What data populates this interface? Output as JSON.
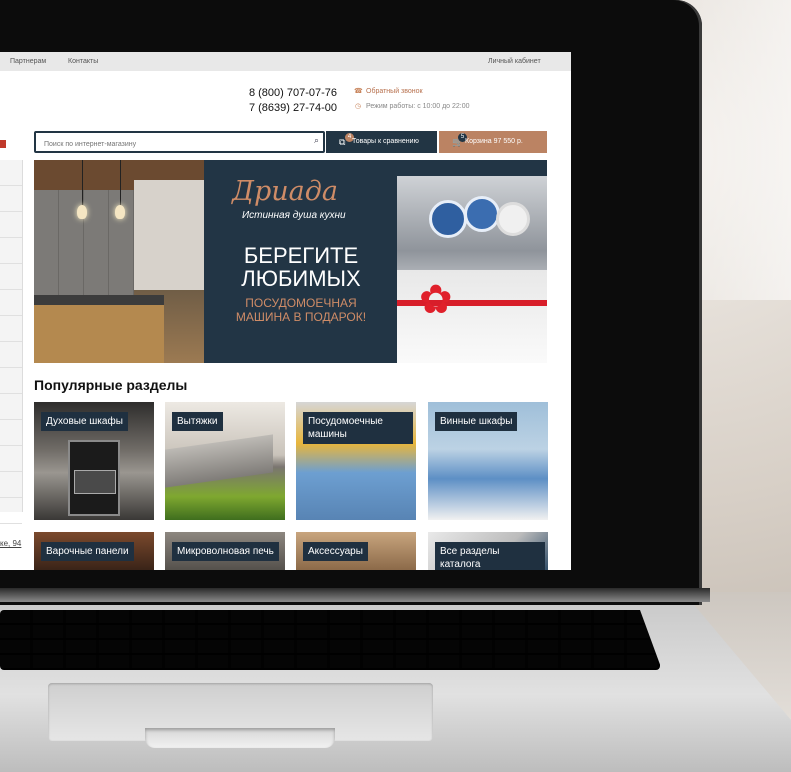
{
  "topbar": {
    "links": [
      "Партнерам",
      "Контакты"
    ],
    "account": "Личный кабинет"
  },
  "contacts": {
    "phone1": "8 (800) 707-07-76",
    "phone2": "7 (8639) 27-74-00",
    "callback": "Обратный звонок",
    "hours": "Режим работы: с 10:00 до 22:00"
  },
  "search": {
    "placeholder": "Поиск по интернет-магазину"
  },
  "compare": {
    "label": "Товары к сравнению",
    "count": "4"
  },
  "cart": {
    "label": "Корзина 97 550 р.",
    "count": "5"
  },
  "banner": {
    "brand": "Дриада",
    "slogan": "Истинная душа кухни",
    "headline": "БЕРЕГИТЕ ЛЮБИМЫХ",
    "subline": "ПОСУДОМОЕЧНАЯ МАШИНА В ПОДАРОК!"
  },
  "popular": {
    "title": "Популярные разделы",
    "tiles": [
      "Духовые шкафы",
      "Вытяжки",
      "Посудомоечные машины",
      "Винные шкафы",
      "Варочные панели",
      "Микроволновая печь",
      "Аксессуары",
      "Все разделы каталога"
    ]
  },
  "sidebar": {
    "address_fragment": "ке, 94"
  },
  "colors": {
    "navy": "#223544",
    "accent": "#bb8363",
    "brand": "#cf8c67"
  }
}
